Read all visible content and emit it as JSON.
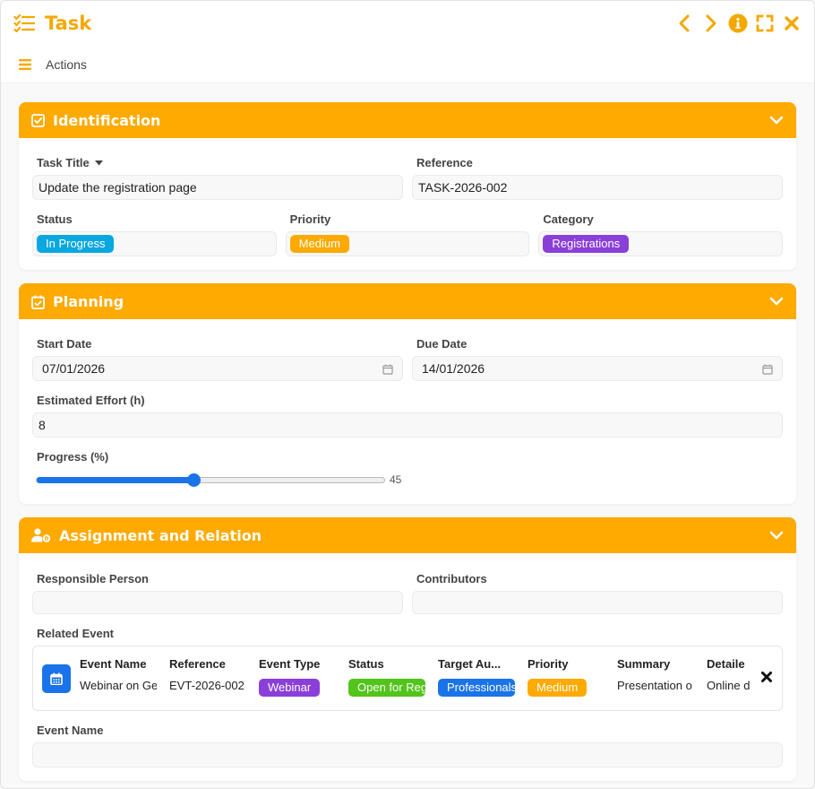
{
  "window": {
    "title": "Task"
  },
  "actions_bar": {
    "label": "Actions"
  },
  "sections": {
    "identification": {
      "title": "Identification",
      "task_title": {
        "label": "Task Title",
        "value": "Update the registration page"
      },
      "reference": {
        "label": "Reference",
        "value": "TASK-2026-002"
      },
      "status": {
        "label": "Status",
        "value": "In Progress",
        "color": "#0aa7e0"
      },
      "priority": {
        "label": "Priority",
        "value": "Medium",
        "color": "#ffaa00"
      },
      "category": {
        "label": "Category",
        "value": "Registrations",
        "color": "#8a3fd9"
      }
    },
    "planning": {
      "title": "Planning",
      "start_date": {
        "label": "Start Date",
        "value": "07/01/2026"
      },
      "due_date": {
        "label": "Due Date",
        "value": "14/01/2026"
      },
      "effort": {
        "label": "Estimated Effort (h)",
        "value": "8"
      },
      "progress": {
        "label": "Progress (%)",
        "value": "45",
        "percent": 45
      }
    },
    "assignment": {
      "title": "Assignment and Relation",
      "responsible": {
        "label": "Responsible Person",
        "value": ""
      },
      "contributors": {
        "label": "Contributors",
        "value": ""
      },
      "related_event": {
        "label": "Related Event",
        "columns": [
          {
            "header": "Event Name",
            "value": "Webinar on Ge"
          },
          {
            "header": "Reference",
            "value": "EVT-2026-002"
          },
          {
            "header": "Event Type",
            "value": "Webinar",
            "color": "#8a3fd9"
          },
          {
            "header": "Status",
            "value": "Open for Registration",
            "color": "#52c41a"
          },
          {
            "header": "Target Au...",
            "value": "Professionals",
            "color": "#1a73e8"
          },
          {
            "header": "Priority",
            "value": "Medium",
            "color": "#ffaa00"
          },
          {
            "header": "Summary",
            "value": "Presentation o"
          },
          {
            "header": "Detaile",
            "value": "Online d"
          }
        ]
      },
      "event_name": {
        "label": "Event Name",
        "value": ""
      }
    }
  },
  "colors": {
    "accent": "#ffaa00",
    "title_accent": "#f5a800",
    "slider": "#1a73e8"
  }
}
